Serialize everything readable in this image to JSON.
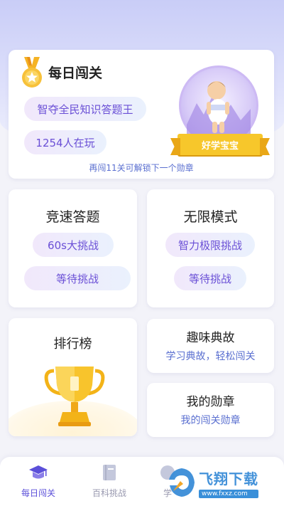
{
  "daily": {
    "title": "每日闯关",
    "tag1": "智夺全民知识答题王",
    "tag2": "1254人在玩",
    "hint": "再闯11关可解锁下一个勋章",
    "badge_label": "好学宝宝"
  },
  "speed": {
    "title": "竞速答题",
    "tag1": "60s大挑战",
    "tag2": "等待挑战"
  },
  "infinite": {
    "title": "无限模式",
    "tag1": "智力极限挑战",
    "tag2": "等待挑战"
  },
  "rank": {
    "title": "排行榜"
  },
  "fun": {
    "title": "趣味典故",
    "subtitle": "学习典故，轻松闯关"
  },
  "medals": {
    "title": "我的勋章",
    "subtitle": "我的闯关勋章"
  },
  "nav": {
    "items": [
      {
        "label": "每日闯关",
        "icon": "graduation-cap-icon"
      },
      {
        "label": "百科挑战",
        "icon": "book-icon"
      },
      {
        "label": "学",
        "icon": "study-icon"
      }
    ]
  },
  "watermark": {
    "cn": "飞翔下载",
    "en": "www.fxxz.com"
  },
  "colors": {
    "accent": "#5b4fd9",
    "link": "#5a6fd0",
    "gold": "#f7c72b"
  }
}
